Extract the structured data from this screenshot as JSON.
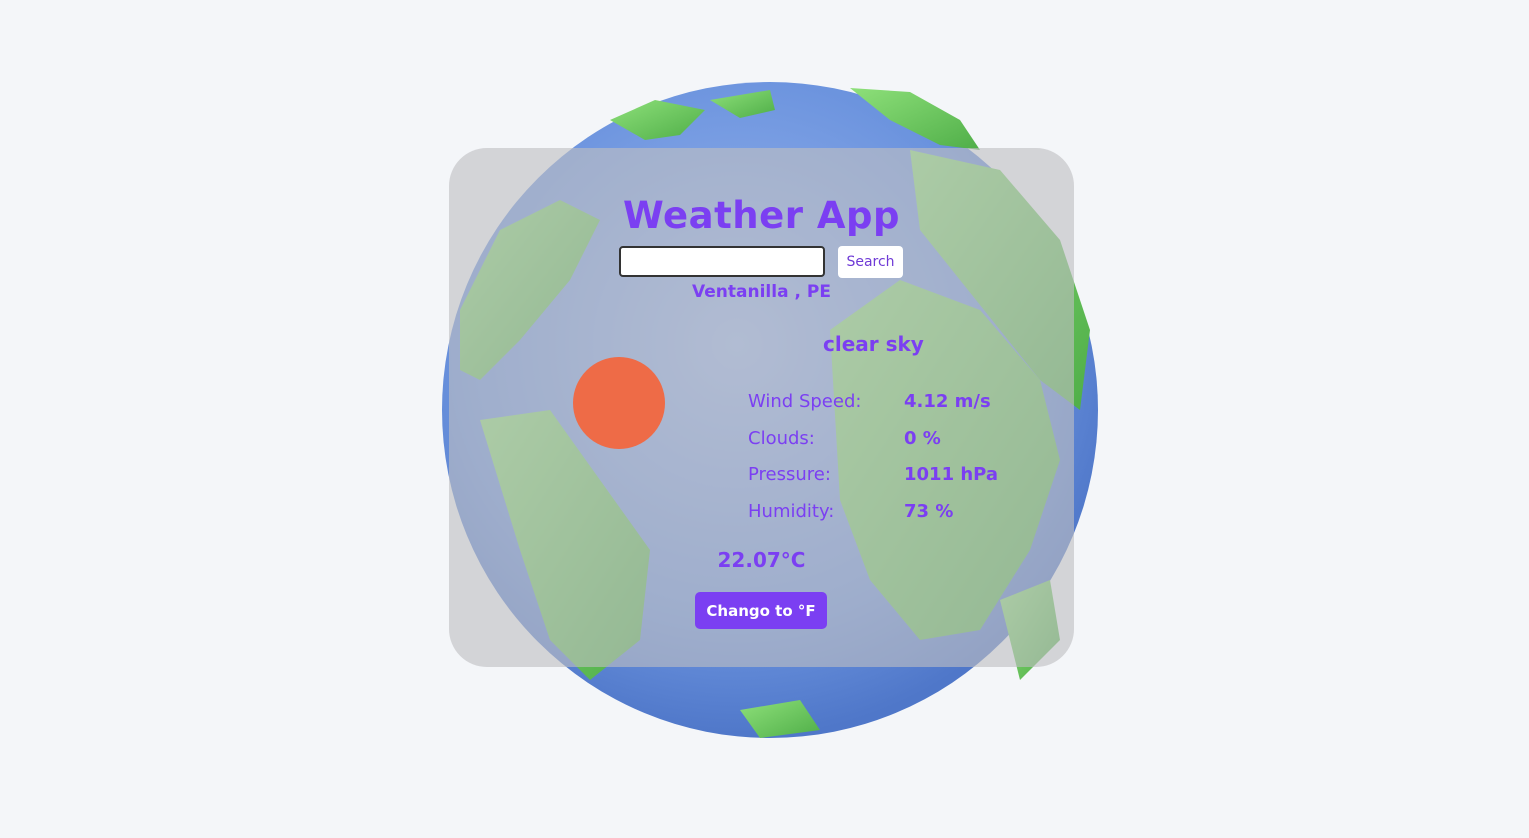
{
  "app": {
    "title": "Weather App"
  },
  "search": {
    "value": "",
    "placeholder": "",
    "button_label": "Search"
  },
  "weather": {
    "location": "Ventanilla , PE",
    "description": "clear sky",
    "icon": "sun-icon",
    "stats": [
      {
        "label": "Wind Speed:",
        "value": "4.12 m/s"
      },
      {
        "label": "Clouds:",
        "value": "0 %"
      },
      {
        "label": "Pressure:",
        "value": "1011 hPa"
      },
      {
        "label": "Humidity:",
        "value": "73 %"
      }
    ],
    "temperature": "22.07°C",
    "toggle_label": "Chango to °F"
  },
  "colors": {
    "accent": "#7b3ff2",
    "sun": "#ee6b47",
    "background": "#f4f6f9",
    "ocean": "#6b93de",
    "land": "#7fcf6e"
  }
}
